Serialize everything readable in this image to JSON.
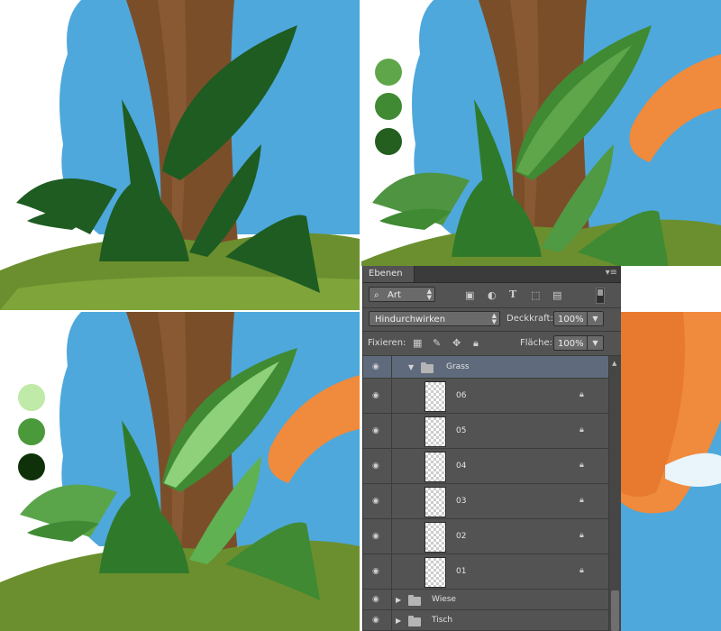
{
  "art_panels": {
    "swatches_stage2": [
      "#5fa64a",
      "#3f8a33",
      "#245f1f"
    ],
    "swatches_stage3": [
      "#bfeaa8",
      "#4a9a3c",
      "#0f3109"
    ],
    "colors": {
      "sky": "#4ea8dc",
      "trunk": "#7b4e2a",
      "flat_leaf": "#1e5c22",
      "fur": "#f08a3c",
      "grass": "#6b8f2e"
    }
  },
  "layers_panel": {
    "tab_label": "Ebenen",
    "filter": {
      "kind_value": "Art"
    },
    "blend_mode": {
      "value": "Hindurchwirken"
    },
    "opacity": {
      "label": "Deckkraft:",
      "value": "100%"
    },
    "lock": {
      "label": "Fixieren:"
    },
    "fill": {
      "label": "Fläche:",
      "value": "100%"
    },
    "group": {
      "name": "Grass",
      "expanded": true
    },
    "sublayers": [
      {
        "name": "06"
      },
      {
        "name": "05"
      },
      {
        "name": "04"
      },
      {
        "name": "03"
      },
      {
        "name": "02"
      },
      {
        "name": "01"
      }
    ],
    "other_groups": [
      {
        "name": "Wiese"
      },
      {
        "name": "Tisch"
      }
    ]
  }
}
